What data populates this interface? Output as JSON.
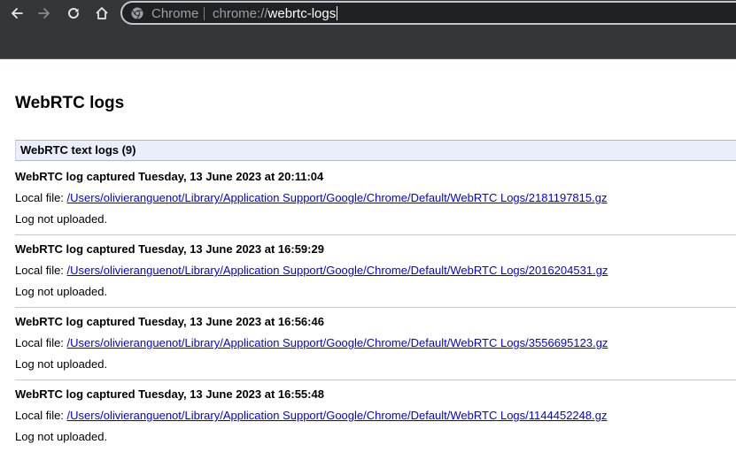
{
  "browser": {
    "omnibox_chip": "Chrome",
    "url_scheme": "chrome://",
    "url_host": "webrtc-logs",
    "icons": {
      "back": "arrow-left-icon",
      "forward": "arrow-right-icon",
      "reload": "reload-icon",
      "home": "home-icon",
      "site": "chrome-logo-icon"
    },
    "colors": {
      "toolbar_bg": "#35363a",
      "omnibox_bg": "#202124",
      "link": "#0000ee",
      "section_header_bg": "#eaeefa"
    }
  },
  "page": {
    "title": "WebRTC logs",
    "section_header": "WebRTC text logs (9)",
    "local_file_label": "Local file: ",
    "logs": [
      {
        "captured": "WebRTC log captured Tuesday, 13 June 2023 at 20:11:04",
        "file_path": "/Users/olivieranguenot/Library/Application Support/Google/Chrome/Default/WebRTC Logs/2181197815.gz",
        "status": "Log not uploaded."
      },
      {
        "captured": "WebRTC log captured Tuesday, 13 June 2023 at 16:59:29",
        "file_path": "/Users/olivieranguenot/Library/Application Support/Google/Chrome/Default/WebRTC Logs/2016204531.gz",
        "status": "Log not uploaded."
      },
      {
        "captured": "WebRTC log captured Tuesday, 13 June 2023 at 16:56:46",
        "file_path": "/Users/olivieranguenot/Library/Application Support/Google/Chrome/Default/WebRTC Logs/3556695123.gz",
        "status": "Log not uploaded."
      },
      {
        "captured": "WebRTC log captured Tuesday, 13 June 2023 at 16:55:48",
        "file_path": "/Users/olivieranguenot/Library/Application Support/Google/Chrome/Default/WebRTC Logs/1144452248.gz",
        "status": "Log not uploaded."
      }
    ]
  }
}
